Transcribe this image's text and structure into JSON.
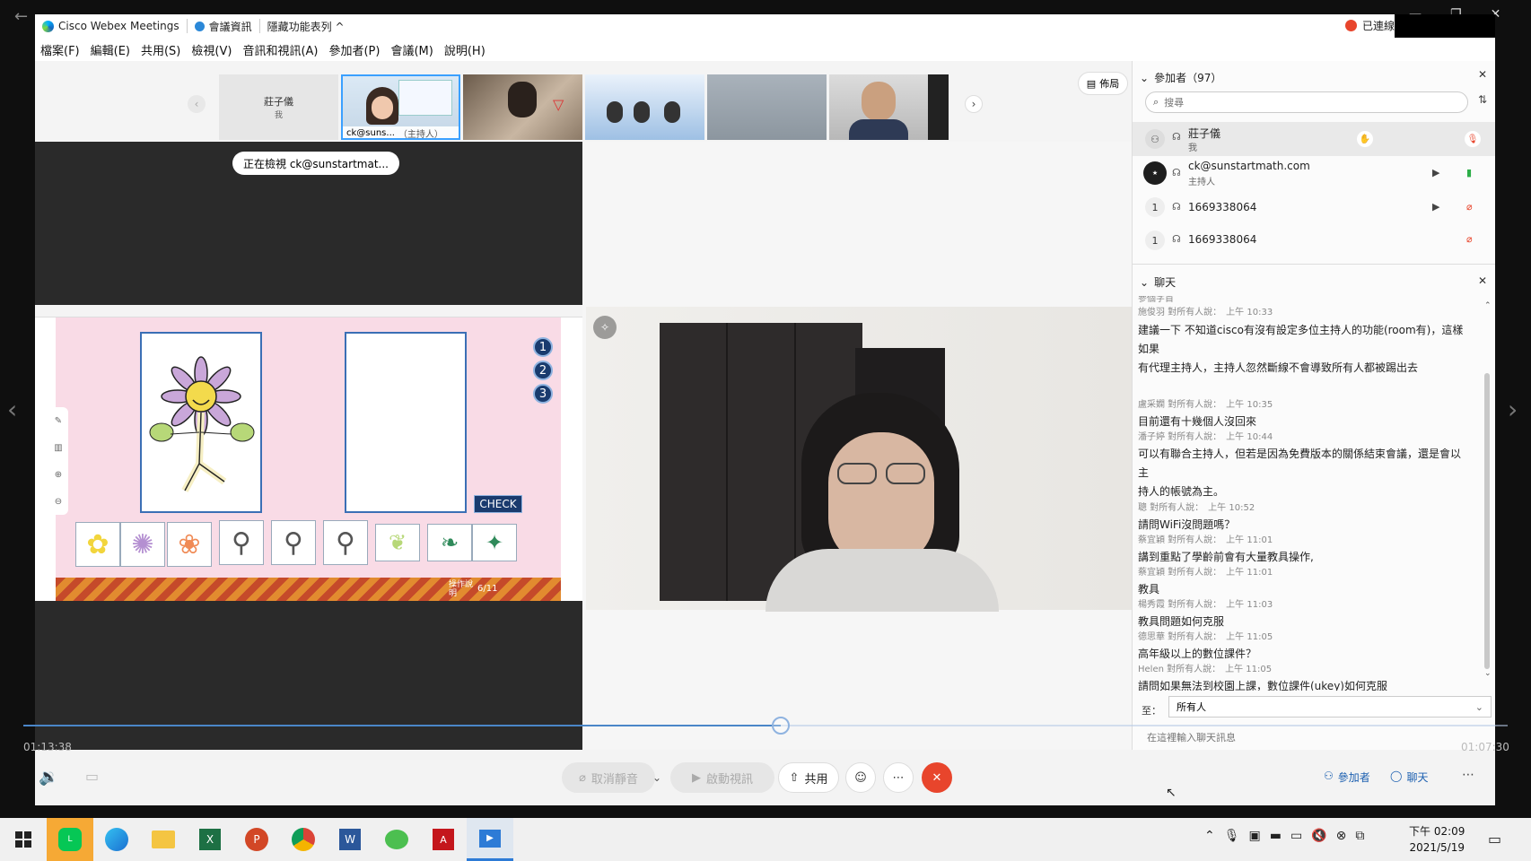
{
  "window": {
    "app_title": "Cisco Webex Meetings",
    "meeting_info": "會議資訊",
    "hide_toolbar": "隱藏功能表列 ^",
    "connected": "已連線"
  },
  "menu": [
    "檔案(F)",
    "編輯(E)",
    "共用(S)",
    "檢視(V)",
    "音訊和視訊(A)",
    "參加者(P)",
    "會議(M)",
    "說明(H)"
  ],
  "thumbnails": {
    "first_name": "莊子儀",
    "first_sub": "我",
    "active_label": "ck@suns...",
    "active_role": "（主持人）",
    "layout_button": "佈局"
  },
  "viewing_label": "正在檢視 ck@sunstartmat...",
  "flash": {
    "check_label": "CHECK",
    "numbers": [
      "1",
      "2",
      "3"
    ],
    "progress": "6/11",
    "help": "操作說明"
  },
  "participants": {
    "header": "參加者（97）",
    "search_placeholder": "搜尋",
    "list": [
      {
        "name": "莊子儀",
        "role": "我",
        "avatar": ""
      },
      {
        "name": "ck@sunstartmath.com",
        "role": "主持人",
        "avatar": ""
      },
      {
        "name": "1669338064",
        "role": "",
        "avatar": "1"
      },
      {
        "name": "1669338064",
        "role": "",
        "avatar": "1"
      }
    ]
  },
  "chat": {
    "header": "聊天",
    "top_cut": "參個字首",
    "messages": [
      {
        "meta": "施俊羽 對所有人說：　上午 10:33",
        "lines": [
          "建議一下 不知道cisco有沒有設定多位主持人的功能(room有)，這樣如果",
          "有代理主持人，主持人忽然斷線不會導致所有人都被踢出去"
        ]
      },
      {
        "meta": "盧采嫻 對所有人說：　上午 10:35",
        "lines": [
          "目前還有十幾個人沒回來"
        ]
      },
      {
        "meta": "潘子婷 對所有人說：　上午 10:44",
        "lines": [
          "可以有聯合主持人，但若是因為免費版本的關係結束會議，還是會以主",
          "持人的帳號為主。"
        ]
      },
      {
        "meta": "聰 對所有人說：　上午 10:52",
        "lines": [
          "請問WiFi沒問題嗎？"
        ]
      },
      {
        "meta": "蔡宜穎 對所有人說：　上午 11:01",
        "lines": [
          "講到重點了學齡前會有大量教具操作,"
        ]
      },
      {
        "meta": "蔡宜穎 對所有人說：　上午 11:01",
        "lines": [
          "教具"
        ]
      },
      {
        "meta": "楊秀霞 對所有人說：　上午 11:03",
        "lines": [
          "教具問題如何克服"
        ]
      },
      {
        "meta": "德思華 對所有人說：　上午 11:05",
        "lines": [
          "高年級以上的數位課件？"
        ]
      },
      {
        "meta": "Helen 對所有人說：　上午 11:05",
        "lines": [
          "請問如果無法到校園上課，數位課件(ukey)如何克服"
        ]
      }
    ],
    "to_label": "至：",
    "to_value": "所有人",
    "input_placeholder": "在這裡輸入聊天訊息"
  },
  "playback": {
    "elapsed": "01:13:38",
    "total": "01:07:30",
    "progress": 0.51
  },
  "controls": {
    "mute": "取消靜音",
    "video": "啟動視訊",
    "share": "共用",
    "participants": "參加者",
    "chat": "聊天"
  },
  "taskbar": {
    "time": "下午 02:09",
    "date": "2021/5/19"
  },
  "colors": {
    "end_button": "#e8452c",
    "webex_blue": "#0074c8",
    "flash_pink": "#f9dbe6"
  }
}
